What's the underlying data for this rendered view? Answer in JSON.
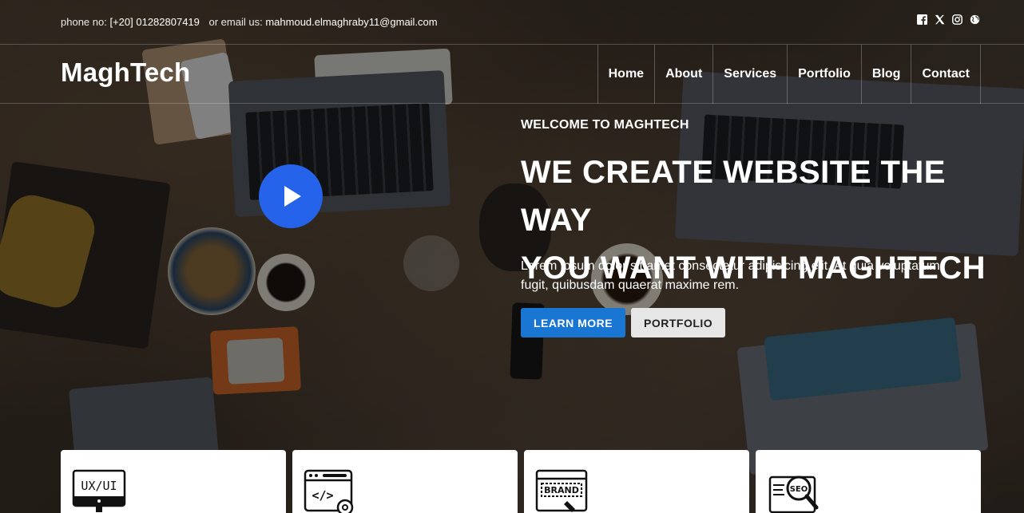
{
  "topbar": {
    "phone_label": "phone no:",
    "phone_value": "[+20] 01282807419",
    "email_label": "or email us:",
    "email_value": "mahmoud.elmaghraby11@gmail.com",
    "social_icons": [
      "facebook-icon",
      "x-twitter-icon",
      "instagram-icon",
      "globe-icon"
    ]
  },
  "header": {
    "logo": "MaghTech",
    "nav": [
      "Home",
      "About",
      "Services",
      "Portfolio",
      "Blog",
      "Contact"
    ]
  },
  "hero": {
    "welcome": "WELCOME TO MAGHTECH",
    "headline_line1": "WE CREATE WEBSITE THE WAY",
    "headline_line2": "YOU WANT WITH MAGHTECH",
    "lead_line1": "Lorem ipsum dolor sit amet consectetur adipisicing elit. At quia voluptatum",
    "lead_line2": "fugit, quibusdam quaerat maxime rem.",
    "primary_button": "LEARN MORE",
    "secondary_button": "PORTFOLIO",
    "play_icon": "play-icon"
  },
  "cards": [
    {
      "icon": "ux-ui-icon",
      "icon_text": "UX/UI"
    },
    {
      "icon": "web-development-icon",
      "icon_text": "</>"
    },
    {
      "icon": "brand-icon",
      "icon_text": "BRAND"
    },
    {
      "icon": "seo-icon",
      "icon_text": "SEO"
    }
  ],
  "colors": {
    "accent_play": "#2563eb",
    "primary_button": "#1976d2",
    "secondary_button": "#e6e6e6"
  }
}
